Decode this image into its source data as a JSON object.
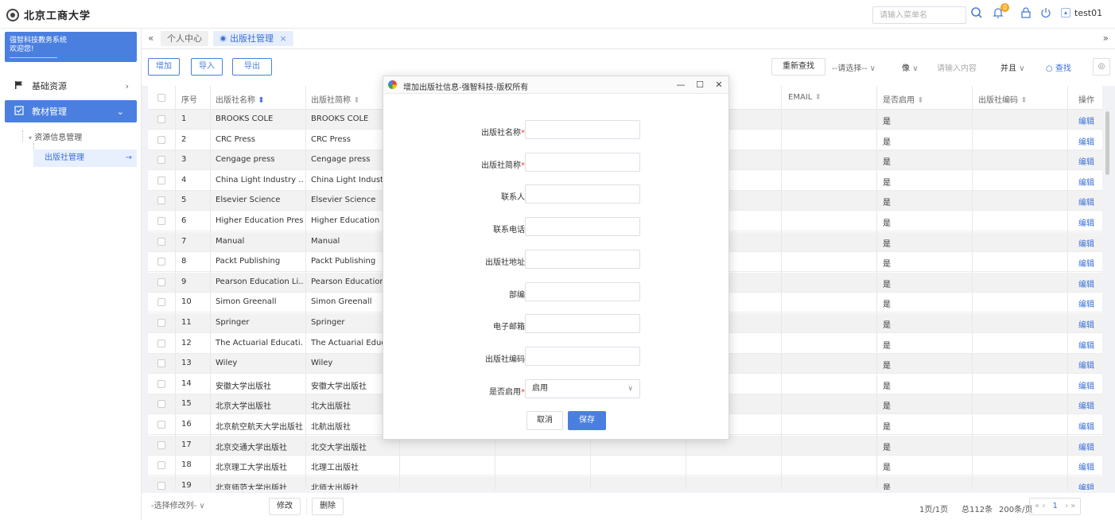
{
  "header": {
    "logo_text": "北京工商大学",
    "search_placeholder": "请输入菜单名",
    "notification_count": "0",
    "username": "test01"
  },
  "sidebar": {
    "profile_line1": "强智科技教务系统",
    "profile_line2": "欢迎您!",
    "items": [
      {
        "label": "基础资源"
      },
      {
        "label": "教材管理"
      }
    ],
    "sub_group": "资源信息管理",
    "sub_active": "出版社管理"
  },
  "tabs": [
    {
      "label": "个人中心"
    },
    {
      "label": "出版社管理"
    }
  ],
  "toolbar": {
    "add": "增加",
    "import": "导入",
    "export": "导出",
    "reset": "重新查找",
    "select_placeholder": "--请选择--",
    "op": "像",
    "content_placeholder": "请输入内容",
    "logic": "并且",
    "search": "查找"
  },
  "table": {
    "headers": [
      "序号",
      "出版社名称",
      "出版社简称",
      "EMAIL",
      "是否启用",
      "出版社编码",
      "操作"
    ],
    "edit_label": "编辑",
    "rows": [
      {
        "no": "1",
        "name": "BROOKS COLE",
        "short": "BROOKS COLE",
        "enabled": "是"
      },
      {
        "no": "2",
        "name": "CRC Press",
        "short": "CRC Press",
        "enabled": "是"
      },
      {
        "no": "3",
        "name": "Cengage press",
        "short": "Cengage press",
        "enabled": "是"
      },
      {
        "no": "4",
        "name": "China Light Industry ...",
        "short": "China Light Industry",
        "enabled": "是"
      },
      {
        "no": "5",
        "name": "Elsevier Science",
        "short": "Elsevier Science",
        "enabled": "是"
      },
      {
        "no": "6",
        "name": "Higher Education Press",
        "short": "Higher Education Pre",
        "enabled": "是"
      },
      {
        "no": "7",
        "name": "Manual",
        "short": "Manual",
        "enabled": "是"
      },
      {
        "no": "8",
        "name": "Packt Publishing",
        "short": "Packt Publishing",
        "enabled": "是"
      },
      {
        "no": "9",
        "name": "Pearson Education Li...",
        "short": "Pearson Education Li",
        "enabled": "是"
      },
      {
        "no": "10",
        "name": "Simon Greenall",
        "short": "Simon Greenall",
        "enabled": "是"
      },
      {
        "no": "11",
        "name": "Springer",
        "short": "Springer",
        "enabled": "是"
      },
      {
        "no": "12",
        "name": "The Actuarial Educati...",
        "short": "The Actuarial Educat",
        "enabled": "是"
      },
      {
        "no": "13",
        "name": "Wiley",
        "short": "Wiley",
        "enabled": "是"
      },
      {
        "no": "14",
        "name": "安徽大学出版社",
        "short": "安徽大学出版社",
        "enabled": "是"
      },
      {
        "no": "15",
        "name": "北京大学出版社",
        "short": "北大出版社",
        "enabled": "是"
      },
      {
        "no": "16",
        "name": "北京航空航天大学出版社",
        "short": "北航出版社",
        "enabled": "是"
      },
      {
        "no": "17",
        "name": "北京交通大学出版社",
        "short": "北交大学出版社",
        "enabled": "是"
      },
      {
        "no": "18",
        "name": "北京理工大学出版社",
        "short": "北理工出版社",
        "enabled": "是"
      },
      {
        "no": "19",
        "name": "北京师范大学出版社",
        "short": "北师大出版社",
        "enabled": "是"
      }
    ]
  },
  "footer": {
    "column_select": "-选择修改列-",
    "modify": "修改",
    "delete": "删除",
    "page_info": "1页/1页",
    "total": "总112条",
    "per_page": "200条/页",
    "current_page": "1"
  },
  "modal": {
    "title": "增加出版社信息-强智科技-版权所有",
    "fields": [
      {
        "label": "出版社名称",
        "required": true
      },
      {
        "label": "出版社简称",
        "required": true
      },
      {
        "label": "联系人",
        "required": false
      },
      {
        "label": "联系电话",
        "required": false
      },
      {
        "label": "出版社地址",
        "required": false
      },
      {
        "label": "部编",
        "required": false
      },
      {
        "label": "电子邮箱",
        "required": false
      },
      {
        "label": "出版社编码",
        "required": false
      }
    ],
    "enabled_label": "是否启用",
    "enabled_value": "启用",
    "cancel": "取消",
    "save": "保存"
  },
  "colors": {
    "primary": "#4a7fe0",
    "link": "#3a6fd8",
    "required": "#e94235",
    "badge": "#f5a623"
  }
}
